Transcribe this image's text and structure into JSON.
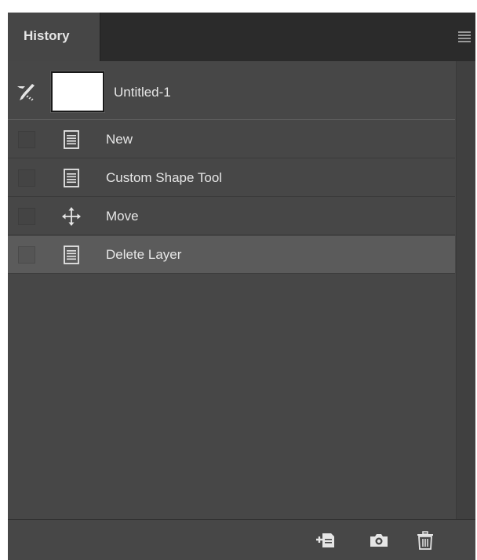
{
  "panel": {
    "tab_label": "History",
    "menu_icon": "panel-menu-icon"
  },
  "snapshot": {
    "label": "Untitled-1",
    "icon": "history-brush-icon",
    "thumbnail_color": "#ffffff"
  },
  "states": [
    {
      "label": "New",
      "icon": "document-icon",
      "selected": false
    },
    {
      "label": "Custom Shape Tool",
      "icon": "document-icon",
      "selected": false
    },
    {
      "label": "Move",
      "icon": "move-icon",
      "selected": false
    },
    {
      "label": "Delete Layer",
      "icon": "document-icon",
      "selected": true
    }
  ],
  "footer": {
    "buttons": [
      "new-document-from-state-icon",
      "camera-icon",
      "trash-icon"
    ]
  },
  "colors": {
    "panel_bg": "#474747",
    "selected_row": "#5b5b5b",
    "text": "#e6e6e6"
  }
}
